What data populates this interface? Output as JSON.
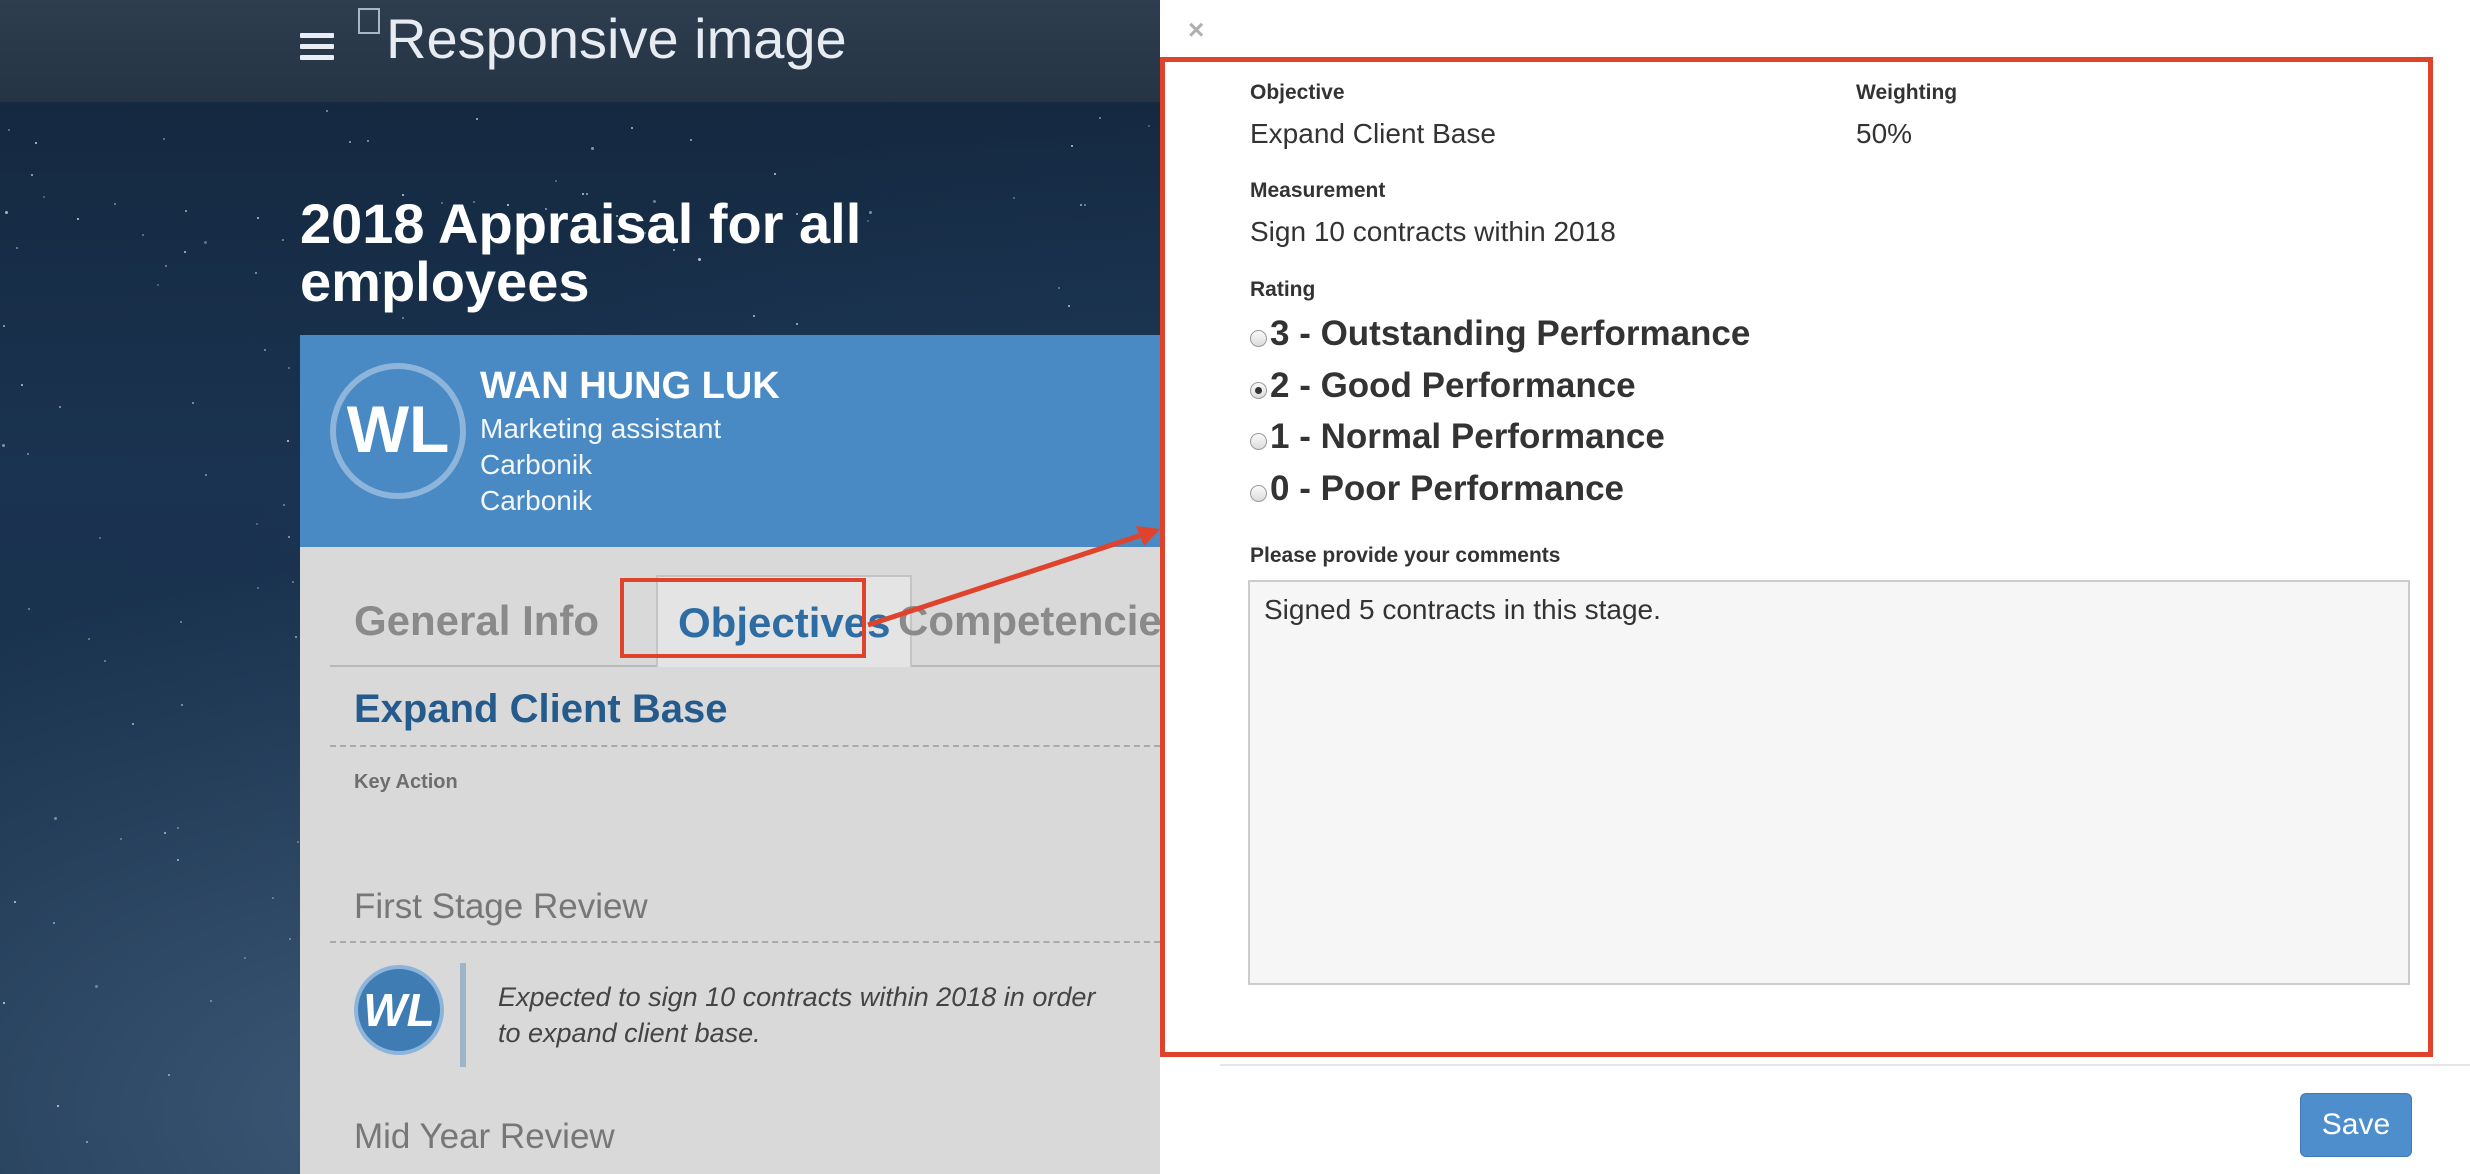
{
  "app": {
    "logo_alt": "Responsive image",
    "page_title": "2018 Appraisal for all employees"
  },
  "employee": {
    "initials": "WL",
    "name": "WAN HUNG LUK",
    "position": "Marketing assistant",
    "department": "Carbonik",
    "company": "Carbonik"
  },
  "tabs": [
    {
      "label": "General Info"
    },
    {
      "label": "Objectives",
      "active": true
    },
    {
      "label": "Competencies"
    }
  ],
  "objective_panel": {
    "title": "Expand Client Base",
    "key_action_label": "Key Action",
    "first_stage_title": "First Stage Review",
    "reviewer_initials": "WL",
    "first_stage_comment": "Expected to sign 10 contracts within 2018 in order to expand client base.",
    "mid_year_title": "Mid Year Review"
  },
  "modal": {
    "close_glyph": "×",
    "objective_label": "Objective",
    "objective_value": "Expand Client Base",
    "weighting_label": "Weighting",
    "weighting_value": "50%",
    "measurement_label": "Measurement",
    "measurement_value": "Sign 10 contracts within 2018",
    "rating_label": "Rating",
    "ratings": [
      {
        "label": "3 - Outstanding Performance",
        "checked": false
      },
      {
        "label": "2 - Good Performance",
        "checked": true
      },
      {
        "label": "1 - Normal Performance",
        "checked": false
      },
      {
        "label": "0 - Poor Performance",
        "checked": false
      }
    ],
    "comments_label": "Please provide your comments",
    "comments_value": "Signed 5 contracts in this stage.",
    "save_label": "Save"
  },
  "colors": {
    "highlight": "#e0432b",
    "header_blue": "#4a8ac4",
    "link_blue": "#2e6da4",
    "save_button": "#4e8ecd"
  }
}
